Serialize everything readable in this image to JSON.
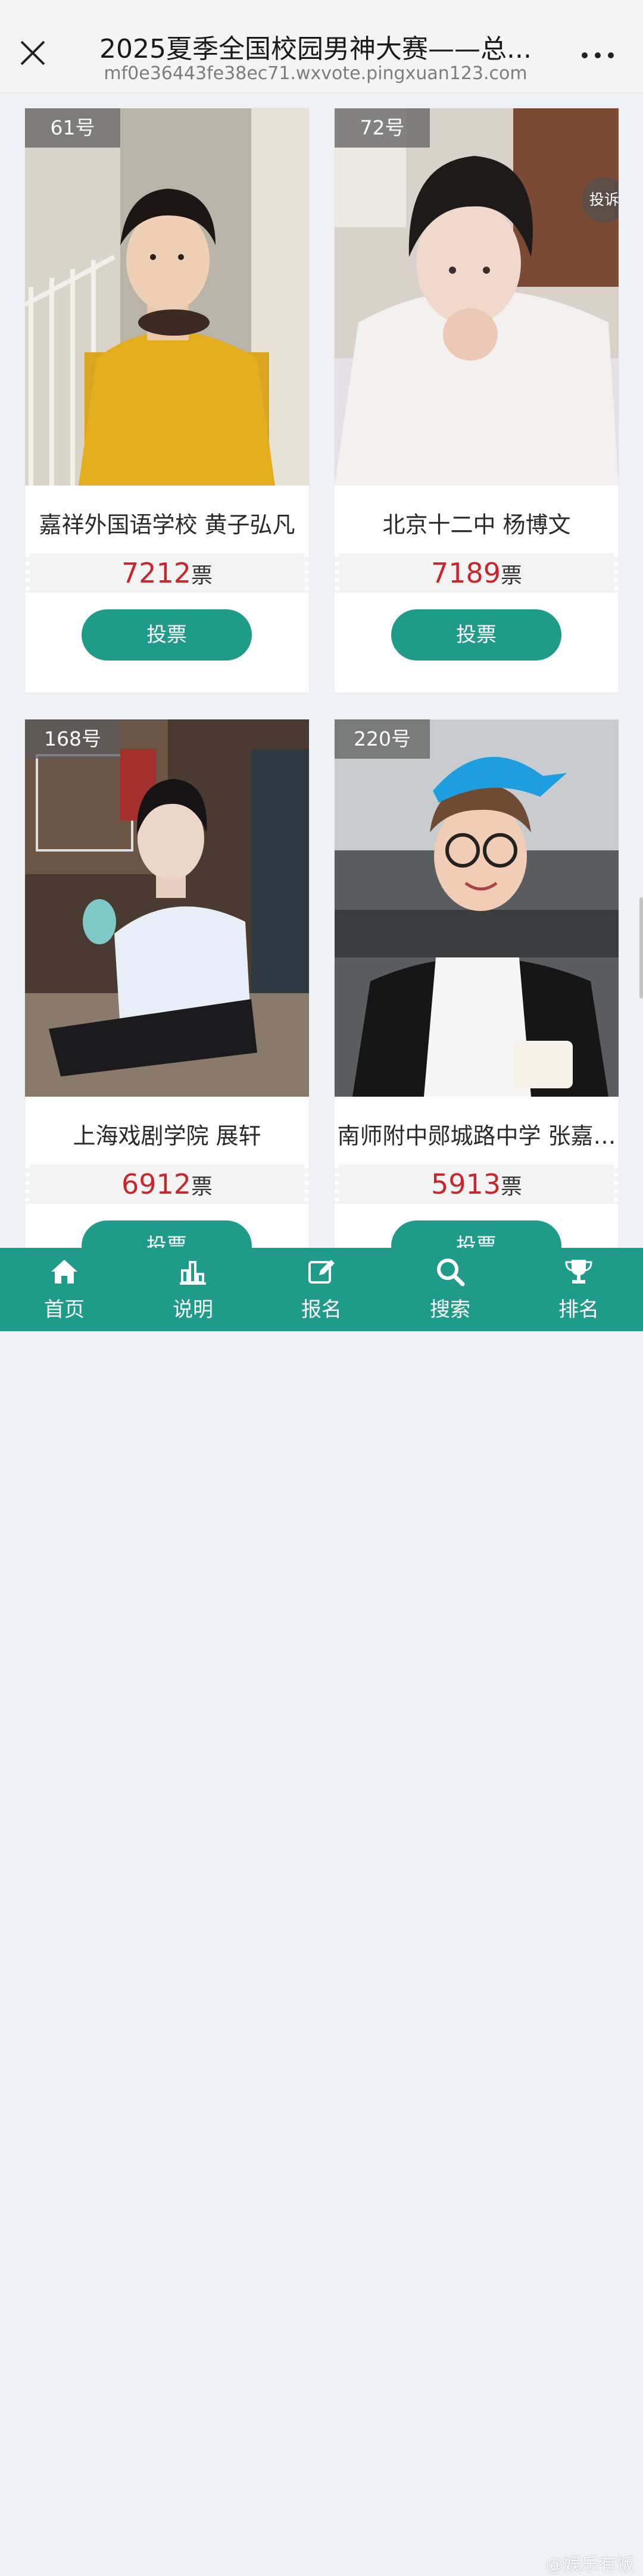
{
  "header": {
    "title": "2025夏季全国校园男神大赛——总...",
    "url": "mf0e36443fe38ec71.wxvote.pingxuan123.com"
  },
  "vote_unit": "票",
  "complain_label": "投诉",
  "candidates": [
    {
      "number": "61号",
      "name": "嘉祥外国语学校 黄子弘凡",
      "votes": "7212",
      "vote_button": "投票"
    },
    {
      "number": "72号",
      "name": "北京十二中 杨博文",
      "votes": "7189",
      "vote_button": "投票"
    },
    {
      "number": "168号",
      "name": "上海戏剧学院 展轩",
      "votes": "6912",
      "vote_button": "投票"
    },
    {
      "number": "220号",
      "name": "南师附中郧城路中学 张嘉…",
      "votes": "5913",
      "vote_button": "投票"
    }
  ],
  "nav": [
    {
      "label": "首页",
      "icon": "home-icon"
    },
    {
      "label": "说明",
      "icon": "bar-chart-icon"
    },
    {
      "label": "报名",
      "icon": "edit-icon"
    },
    {
      "label": "搜索",
      "icon": "search-icon"
    },
    {
      "label": "排名",
      "icon": "trophy-icon"
    }
  ],
  "watermark": "@娱乐有饭",
  "colors": {
    "accent": "#1e9b89",
    "vote_count": "#c8262a"
  }
}
